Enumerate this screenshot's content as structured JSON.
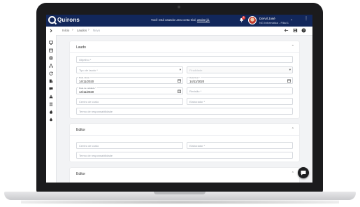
{
  "header": {
    "logo_text": "Quirons",
    "trial_text": "Você está usando uma conta trial,",
    "trial_link": "assine já.",
    "notification_count": "8",
    "user_name": "Dervil José",
    "user_company": "NG Informática - Filial 1"
  },
  "breadcrumb": {
    "items": [
      "Início",
      "Laudos",
      "Novo"
    ]
  },
  "laudo_card": {
    "title": "Laudo",
    "fields": {
      "objetivo": {
        "placeholder": "Objetivo *"
      },
      "tipo_laudo": {
        "placeholder": "Tipo de laudo *"
      },
      "finalidade": {
        "placeholder": "Finalidade"
      },
      "data_inicial": {
        "label": "Data inicial",
        "value": "14/11/2020"
      },
      "data_final": {
        "label": "Data final *",
        "value": "14/11/2020"
      },
      "data_validade": {
        "label": "Data de validade *",
        "value": "14/11/2020"
      },
      "revisao": {
        "placeholder": "Revisão *"
      },
      "centro_custo": {
        "placeholder": "Centro de custo"
      },
      "elaborador": {
        "placeholder": "Elaborador *"
      },
      "termo": {
        "placeholder": "Termo de responsabilidade"
      }
    }
  },
  "editor_card": {
    "title": "Editor",
    "fields": {
      "centro_custo": {
        "placeholder": "Centro de custo"
      },
      "elaborador": {
        "placeholder": "Elaborador *"
      },
      "termo": {
        "placeholder": "Termo de responsabilidade"
      }
    }
  },
  "editor_card_2": {
    "title": "Editor"
  },
  "colors": {
    "topbar": "#12275b",
    "background": "#f2f3f5",
    "fab": "#1e1e20",
    "badge": "#e53935"
  },
  "icons": [
    "chevron-right-icon",
    "monitor-icon",
    "calendar-icon",
    "target-icon",
    "sitemap-icon",
    "refresh-icon",
    "building-icon",
    "chat-icon",
    "warning-icon",
    "list-icon",
    "flame-icon",
    "drop-icon",
    "back-arrow-icon",
    "save-icon",
    "help-icon",
    "bell-icon",
    "more-icon",
    "chat-fab-icon"
  ]
}
